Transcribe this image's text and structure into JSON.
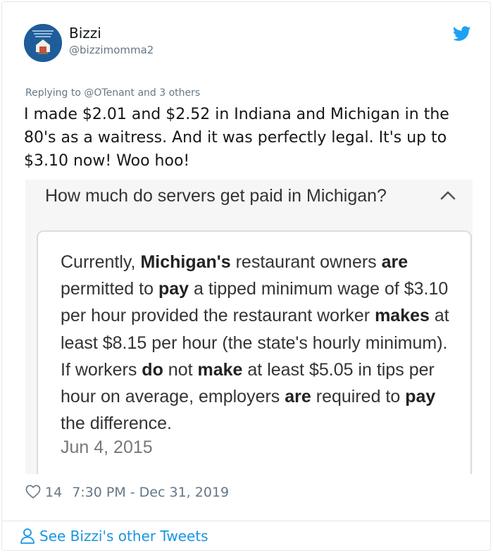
{
  "author": {
    "name": "Bizzi",
    "handle": "@bizzimomma2"
  },
  "reply": {
    "prefix": "Replying to",
    "mention": "@OTenant",
    "suffix": "and 3 others"
  },
  "tweet_text": "I made $2.01 and $2.52 in Indiana and Michigan in the 80's as a waitress. And it was perfectly legal. It's up to $3.10 now!  Woo hoo!",
  "embed": {
    "question": "How much do servers get paid in Michigan?",
    "answer_parts": [
      {
        "text": "Currently, ",
        "bold": false
      },
      {
        "text": "Michigan's",
        "bold": true
      },
      {
        "text": " restaurant owners ",
        "bold": false
      },
      {
        "text": "are",
        "bold": true
      },
      {
        "text": " permitted to ",
        "bold": false
      },
      {
        "text": "pay",
        "bold": true
      },
      {
        "text": " a tipped minimum wage of $3.10 per hour provided the restaurant worker ",
        "bold": false
      },
      {
        "text": "makes",
        "bold": true
      },
      {
        "text": " at least $8.15 per hour (the state's hourly minimum). If workers ",
        "bold": false
      },
      {
        "text": "do",
        "bold": true
      },
      {
        "text": " not ",
        "bold": false
      },
      {
        "text": "make",
        "bold": true
      },
      {
        "text": " at least $5.05 in tips per hour on average, employers ",
        "bold": false
      },
      {
        "text": "are",
        "bold": true
      },
      {
        "text": " required to ",
        "bold": false
      },
      {
        "text": "pay",
        "bold": true
      },
      {
        "text": " the difference.",
        "bold": false
      }
    ],
    "date": "Jun 4, 2015"
  },
  "meta": {
    "likes": "14",
    "timestamp": "7:30 PM - Dec 31, 2019"
  },
  "footer": {
    "see_other": "See Bizzi's other Tweets"
  },
  "icons": {
    "brand": "twitter-bird-icon",
    "like": "heart-icon",
    "profile": "person-icon",
    "collapse": "chevron-up-icon"
  },
  "colors": {
    "twitter_blue": "#1da1f2",
    "link_blue": "#1b95e0",
    "muted_gray": "#657786"
  }
}
